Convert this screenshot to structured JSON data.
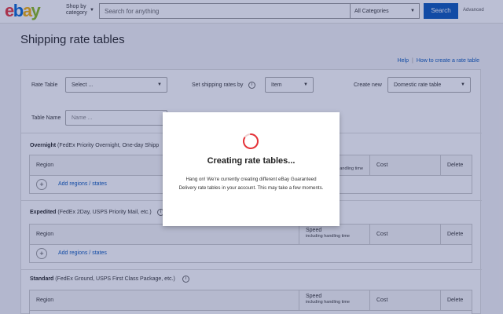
{
  "header": {
    "logo_letters": [
      "e",
      "b",
      "a",
      "y"
    ],
    "shop_by": "Shop by category",
    "search_placeholder": "Search for anything",
    "category": "All Categories",
    "search_button": "Search",
    "advanced": "Advanced"
  },
  "page": {
    "title": "Shipping rate tables",
    "help": "Help",
    "how_to": "How to create a rate table"
  },
  "form": {
    "rate_table_label": "Rate Table",
    "rate_table_value": "Select ...",
    "set_rates_label": "Set shipping rates by",
    "set_rates_value": "Item",
    "create_new_label": "Create new",
    "create_new_value": "Domestic rate table",
    "table_name_label": "Table Name",
    "table_name_placeholder": "Name ..."
  },
  "sections": [
    {
      "title": "Overnight",
      "subtitle": " (FedEx Priority Overnight, One-day Shipp",
      "columns": {
        "region": "Region",
        "speed": "",
        "speed_sub": "handling time",
        "cost": "Cost",
        "delete": "Delete"
      },
      "add": "Add regions / states"
    },
    {
      "title": "Expedited",
      "subtitle": " (FedEx 2Day, USPS Priority Mail, etc.)",
      "columns": {
        "region": "Region",
        "speed": "Speed",
        "speed_sub": "including handling time",
        "cost": "Cost",
        "delete": "Delete"
      },
      "add": "Add regions / states"
    },
    {
      "title": "Standard",
      "subtitle": " (FedEx Ground, USPS First Class Package, etc.)",
      "columns": {
        "region": "Region",
        "speed": "Speed",
        "speed_sub": "including handling time",
        "cost": "Cost",
        "delete": "Delete"
      },
      "add": ""
    }
  ],
  "modal": {
    "title": "Creating rate tables...",
    "body": "Hang on! We're currently creating different eBay Guaranteed Delivery rate tables in your account. This may take a few moments."
  },
  "colors": {
    "accent": "#0654ba",
    "spinner": "#e53238",
    "overlay": "#2d3778"
  }
}
